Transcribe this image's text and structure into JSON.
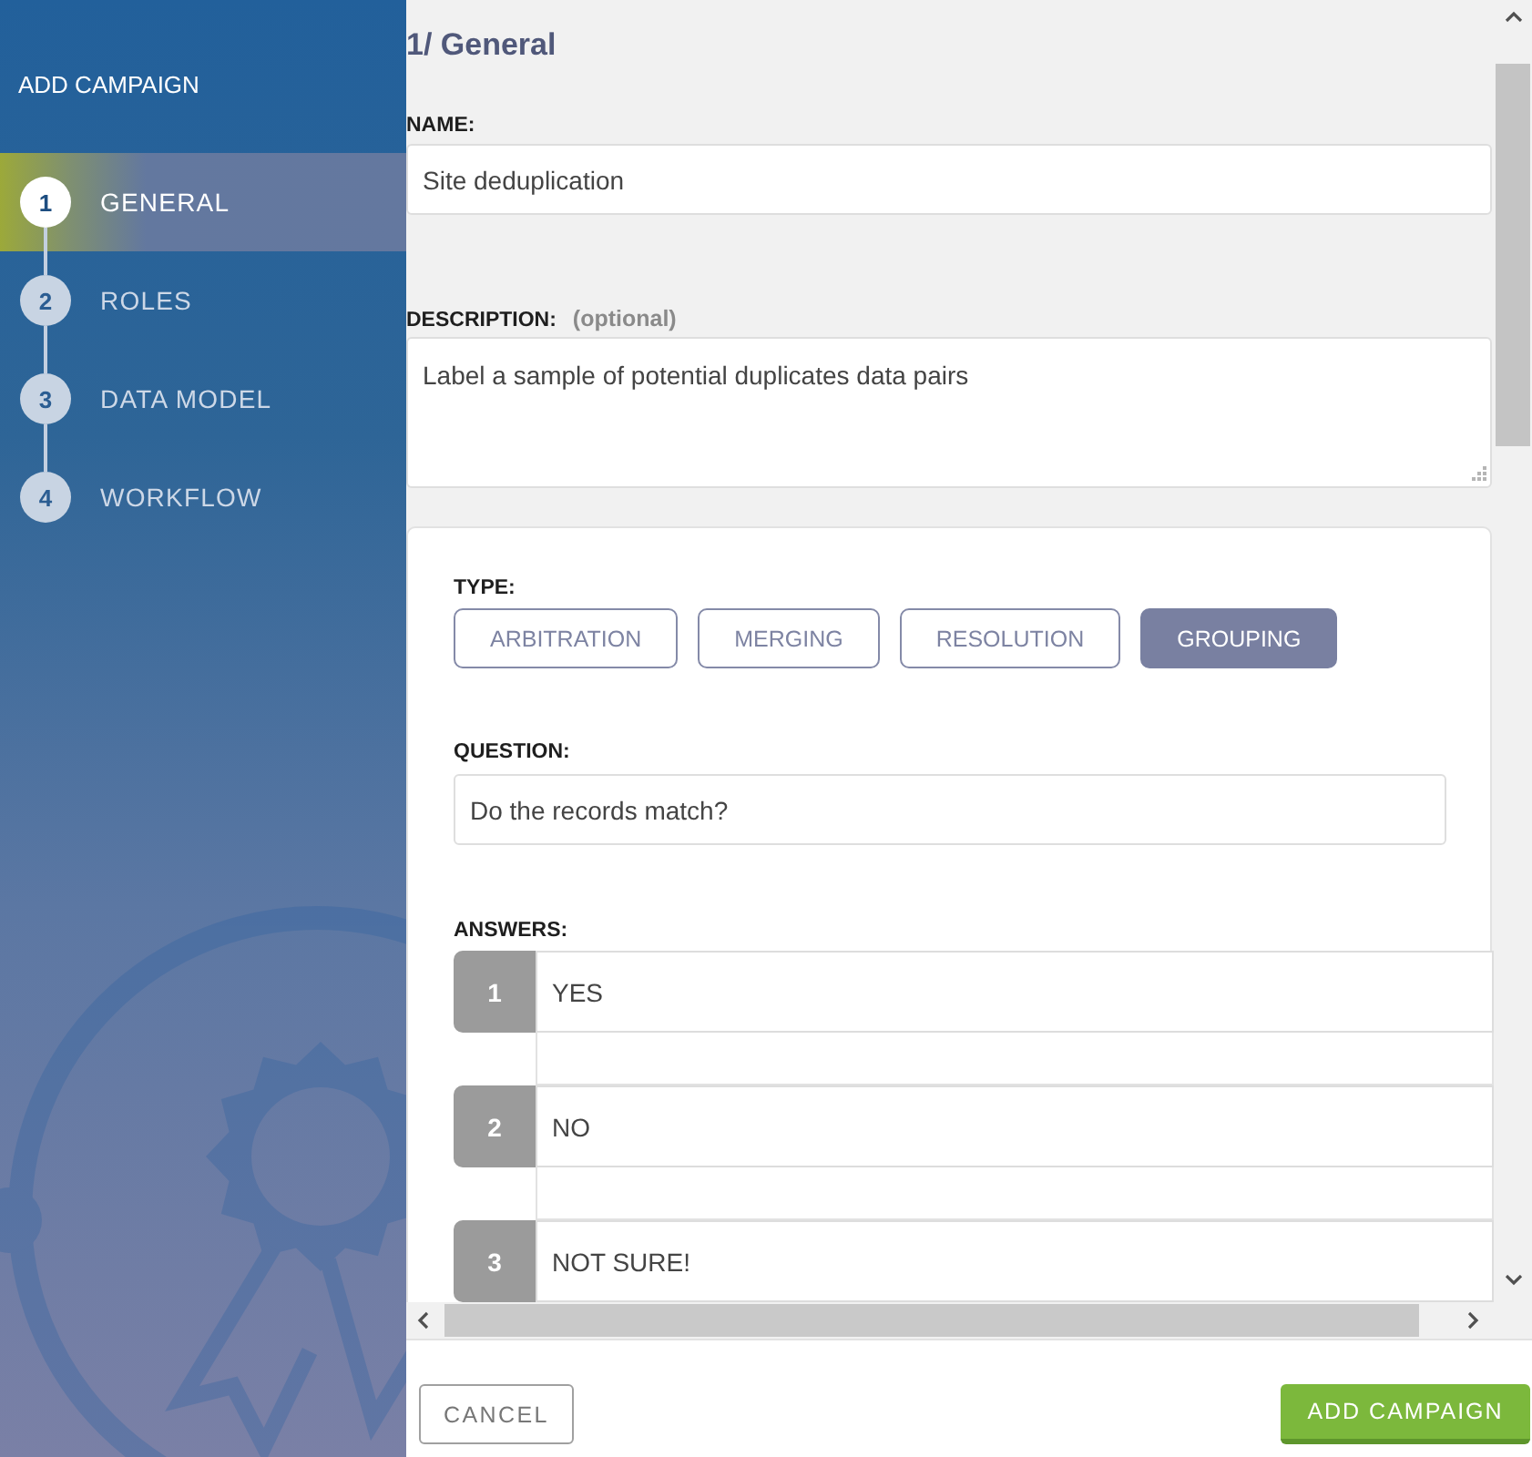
{
  "sidebar": {
    "title": "ADD CAMPAIGN",
    "steps": [
      {
        "number": "1",
        "label": "GENERAL",
        "selected": true
      },
      {
        "number": "2",
        "label": "ROLES",
        "selected": false
      },
      {
        "number": "3",
        "label": "DATA MODEL",
        "selected": false
      },
      {
        "number": "4",
        "label": "WORKFLOW",
        "selected": false
      }
    ]
  },
  "form": {
    "heading": "1/ General",
    "name": {
      "label": "NAME:",
      "value": "Site deduplication"
    },
    "description": {
      "label": "DESCRIPTION:",
      "hint": "(optional)",
      "value": "Label a sample of potential duplicates data pairs"
    },
    "type": {
      "label": "TYPE:",
      "options": [
        {
          "label": "ARBITRATION",
          "selected": false
        },
        {
          "label": "MERGING",
          "selected": false
        },
        {
          "label": "RESOLUTION",
          "selected": false
        },
        {
          "label": "GROUPING",
          "selected": true
        }
      ]
    },
    "question": {
      "label": "QUESTION:",
      "value": "Do the records match?"
    },
    "answers": {
      "label": "ANSWERS:",
      "items": [
        {
          "number": "1",
          "value": "YES"
        },
        {
          "number": "2",
          "value": "NO"
        },
        {
          "number": "3",
          "value": "NOT SURE!"
        }
      ]
    }
  },
  "footer": {
    "buttons": [
      {
        "label": "CANCEL",
        "kind": "secondary"
      },
      {
        "label": "ADD CAMPAIGN",
        "kind": "primary"
      }
    ]
  }
}
